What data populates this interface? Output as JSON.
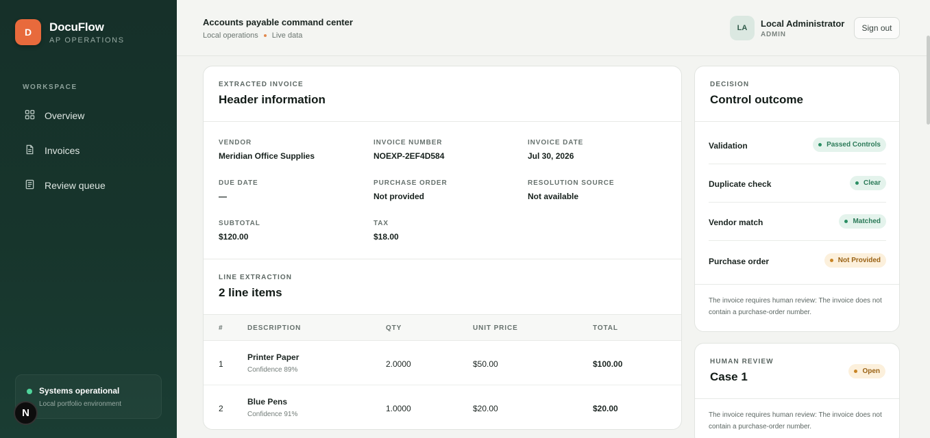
{
  "app": {
    "logo_letter": "D",
    "name": "DocuFlow",
    "subtitle": "AP OPERATIONS"
  },
  "sidebar": {
    "heading": "WORKSPACE",
    "items": [
      {
        "label": "Overview",
        "icon": "grid-icon"
      },
      {
        "label": "Invoices",
        "icon": "document-icon"
      },
      {
        "label": "Review queue",
        "icon": "list-document-icon"
      }
    ],
    "status": {
      "title": "Systems operational",
      "subtitle": "Local portfolio environment",
      "color": "#4fd49b"
    },
    "next_badge": "N"
  },
  "header": {
    "title": "Accounts payable command center",
    "breadcrumb": [
      "Local operations",
      "Live data"
    ],
    "user": {
      "initials": "LA",
      "name": "Local Administrator",
      "role": "ADMIN"
    },
    "sign_out_label": "Sign out"
  },
  "invoice": {
    "eyebrow": "EXTRACTED INVOICE",
    "title": "Header information",
    "fields": {
      "vendor": {
        "label": "VENDOR",
        "value": "Meridian Office Supplies"
      },
      "invoice_number": {
        "label": "INVOICE NUMBER",
        "value": "NOEXP-2EF4D584"
      },
      "invoice_date": {
        "label": "INVOICE DATE",
        "value": "Jul 30, 2026"
      },
      "due_date": {
        "label": "DUE DATE",
        "value": "—"
      },
      "purchase_order": {
        "label": "PURCHASE ORDER",
        "value": "Not provided"
      },
      "resolution_source": {
        "label": "RESOLUTION SOURCE",
        "value": "Not available"
      },
      "subtotal": {
        "label": "SUBTOTAL",
        "value": "$120.00"
      },
      "tax": {
        "label": "TAX",
        "value": "$18.00"
      }
    },
    "lines": {
      "eyebrow": "LINE EXTRACTION",
      "title": "2 line items",
      "columns": [
        "#",
        "DESCRIPTION",
        "QTY",
        "UNIT PRICE",
        "TOTAL"
      ],
      "rows": [
        {
          "num": "1",
          "description": "Printer Paper",
          "confidence": "Confidence 89%",
          "qty": "2.0000",
          "unit_price": "$50.00",
          "total": "$100.00"
        },
        {
          "num": "2",
          "description": "Blue Pens",
          "confidence": "Confidence 91%",
          "qty": "1.0000",
          "unit_price": "$20.00",
          "total": "$20.00"
        }
      ]
    }
  },
  "decision": {
    "eyebrow": "DECISION",
    "title": "Control outcome",
    "checks": [
      {
        "label": "Validation",
        "status": "Passed Controls",
        "tone": "green"
      },
      {
        "label": "Duplicate check",
        "status": "Clear",
        "tone": "green"
      },
      {
        "label": "Vendor match",
        "status": "Matched",
        "tone": "green"
      },
      {
        "label": "Purchase order",
        "status": "Not Provided",
        "tone": "amber"
      }
    ],
    "note": "The invoice requires human review: The invoice does not contain a purchase-order number."
  },
  "review": {
    "eyebrow": "HUMAN REVIEW",
    "title": "Case 1",
    "status": "Open",
    "note": "The invoice requires human review: The invoice does not contain a purchase-order number."
  },
  "colors": {
    "sidebar_bg": "#163029",
    "accent": "#e86a3c",
    "pass": "#2b7a58",
    "warn": "#9a6214"
  }
}
